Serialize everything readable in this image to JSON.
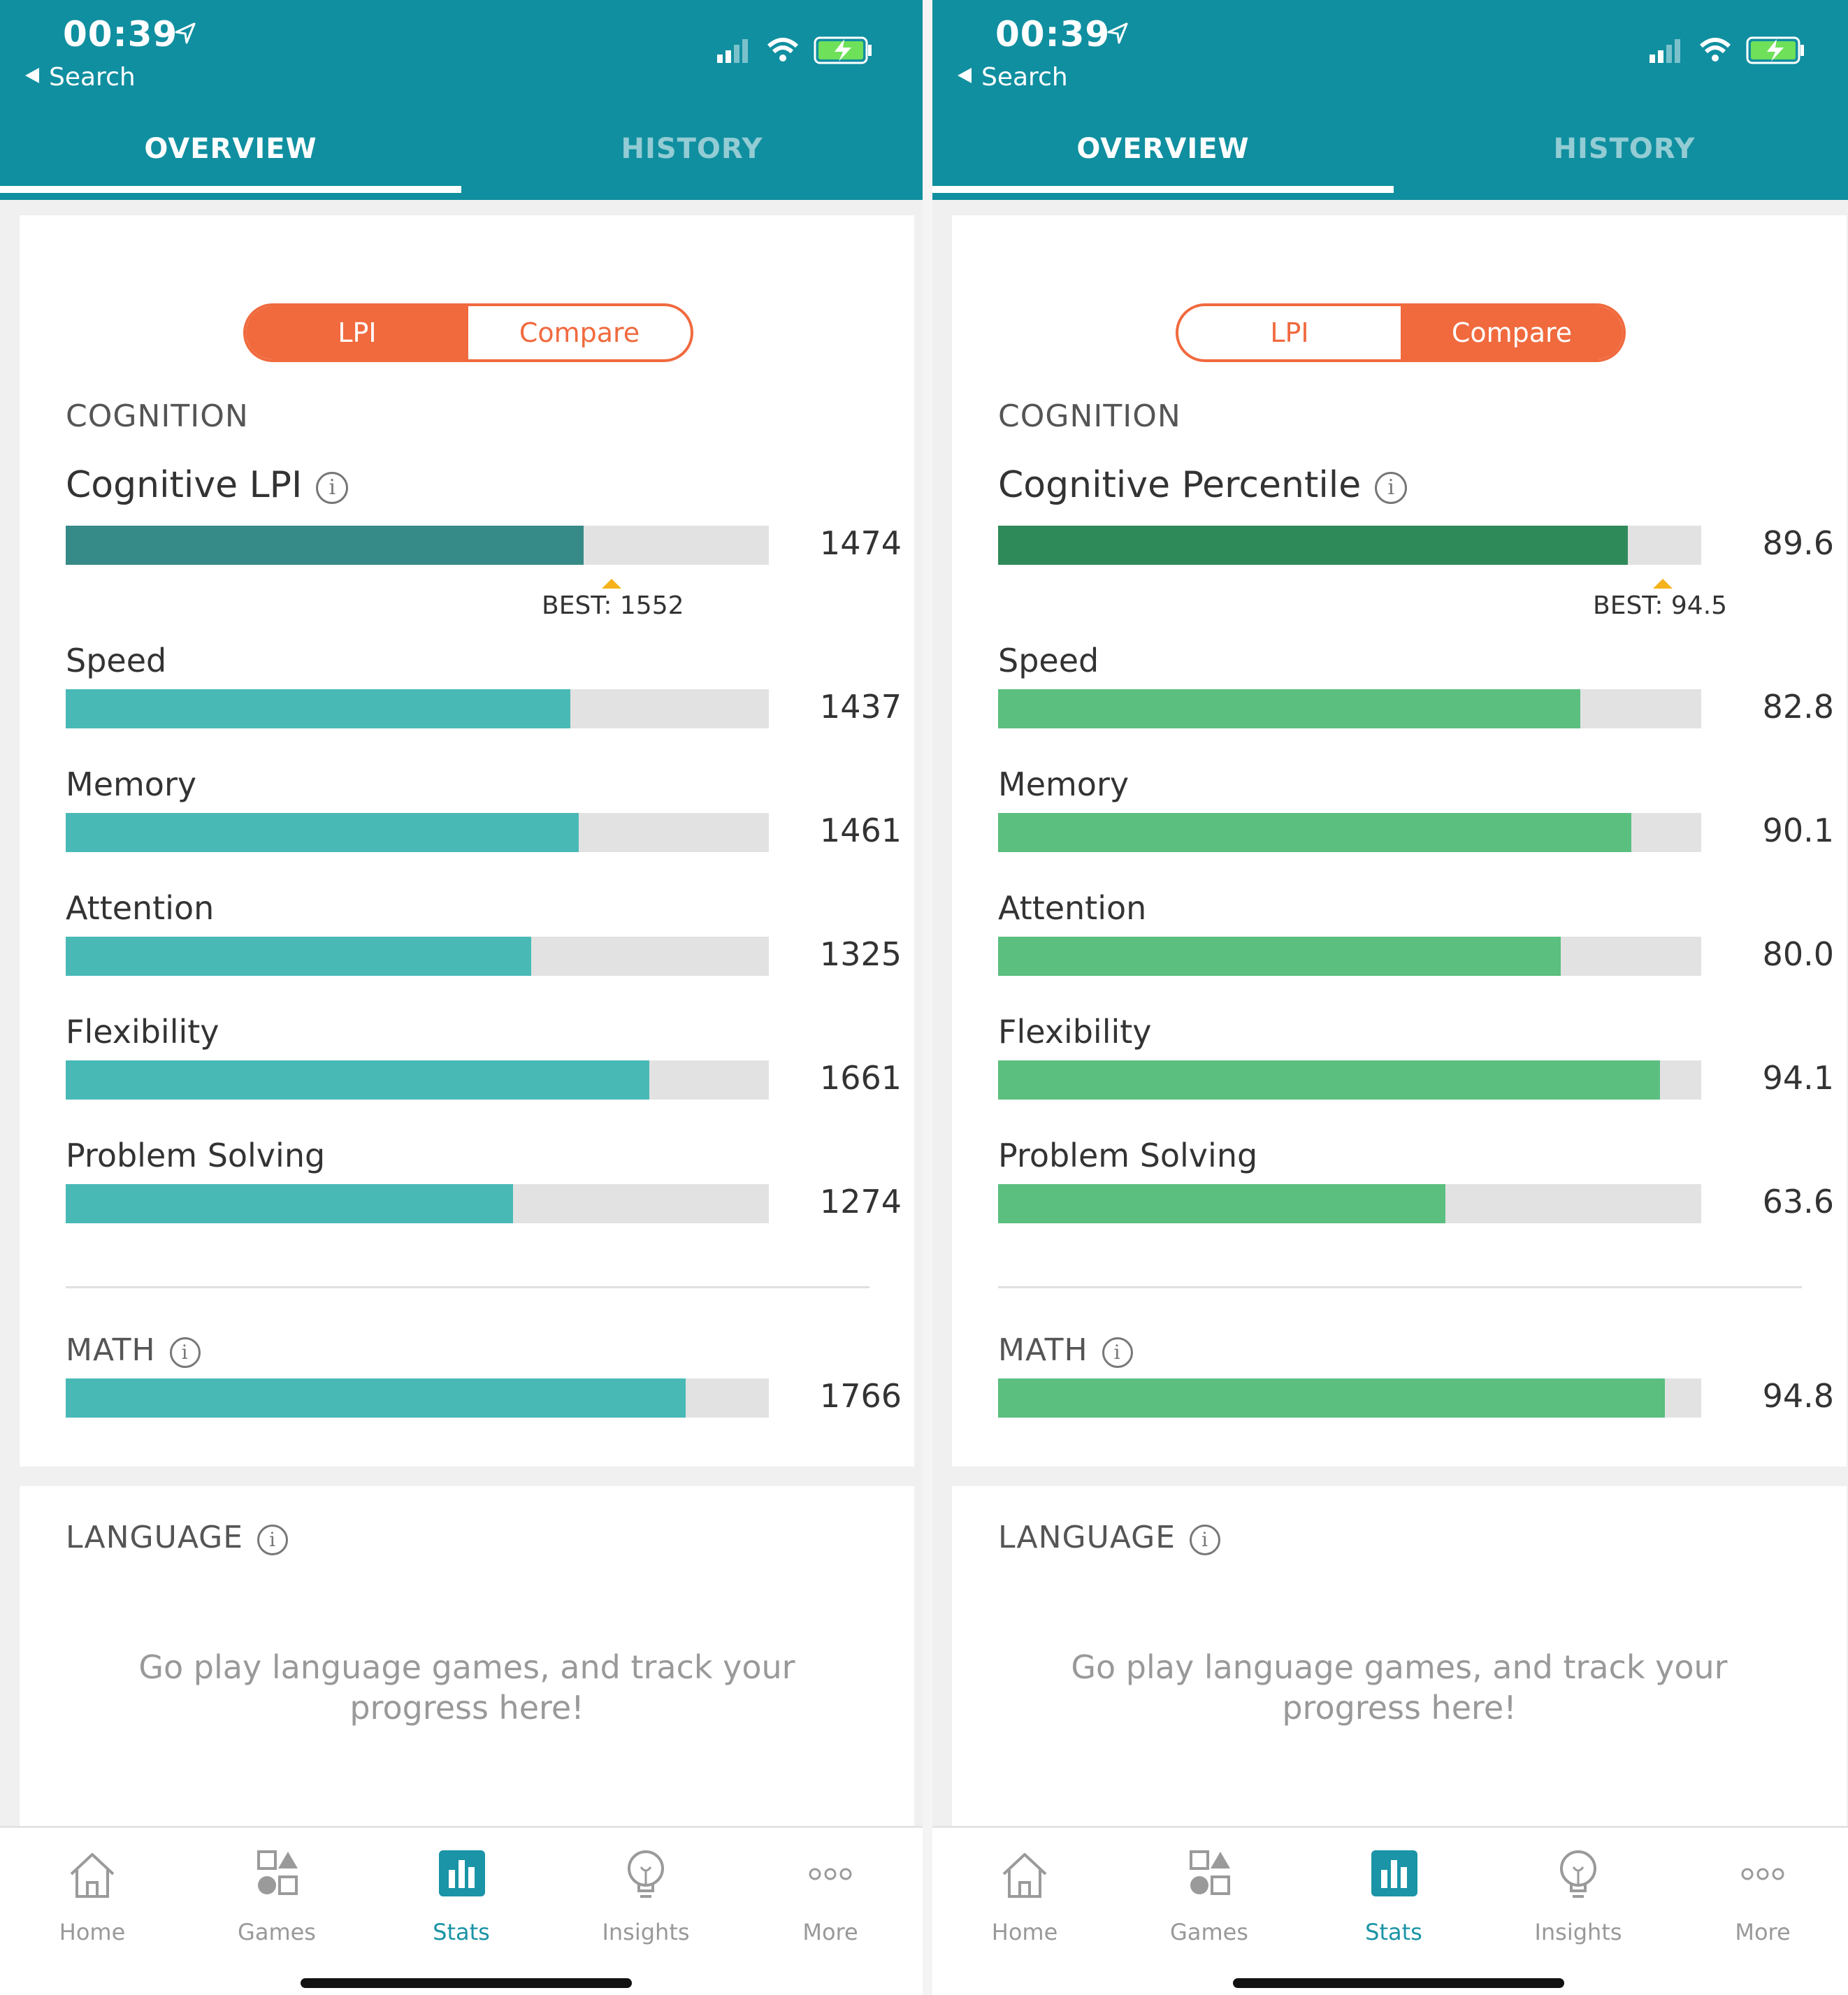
{
  "screens": [
    {
      "status_bar": {
        "time": "00:39",
        "back_label": "Search"
      },
      "tabs": {
        "overview": "OVERVIEW",
        "history": "HISTORY",
        "active": "overview"
      },
      "toggle": {
        "first": "LPI",
        "second": "Compare",
        "active": "first"
      },
      "cognition": {
        "title": "COGNITION",
        "metric_title": "Cognitive LPI",
        "overall": {
          "value": "1474",
          "fraction": 0.737,
          "best_label": "BEST: 1552",
          "best_fraction": 0.776
        },
        "items": [
          {
            "label": "Speed",
            "value": "1437",
            "fraction": 0.718
          },
          {
            "label": "Memory",
            "value": "1461",
            "fraction": 0.73
          },
          {
            "label": "Attention",
            "value": "1325",
            "fraction": 0.662
          },
          {
            "label": "Flexibility",
            "value": "1661",
            "fraction": 0.83
          },
          {
            "label": "Problem Solving",
            "value": "1274",
            "fraction": 0.636
          }
        ]
      },
      "math": {
        "title": "MATH",
        "value": "1766",
        "fraction": 0.882
      },
      "language": {
        "title": "LANGUAGE",
        "message": "Go play language games, and track your progress here!"
      },
      "colors": {
        "overall_bar": "#368a87",
        "bar": "#49b9b6",
        "track": "#e2e2e2"
      }
    },
    {
      "status_bar": {
        "time": "00:39",
        "back_label": "Search"
      },
      "tabs": {
        "overview": "OVERVIEW",
        "history": "HISTORY",
        "active": "overview"
      },
      "toggle": {
        "first": "LPI",
        "second": "Compare",
        "active": "second"
      },
      "cognition": {
        "title": "COGNITION",
        "metric_title": "Cognitive Percentile",
        "overall": {
          "value": "89.6",
          "fraction": 0.896,
          "best_label": "BEST: 94.5",
          "best_fraction": 0.945
        },
        "items": [
          {
            "label": "Speed",
            "value": "82.8",
            "fraction": 0.828
          },
          {
            "label": "Memory",
            "value": "90.1",
            "fraction": 0.901
          },
          {
            "label": "Attention",
            "value": "80.0",
            "fraction": 0.8
          },
          {
            "label": "Flexibility",
            "value": "94.1",
            "fraction": 0.941
          },
          {
            "label": "Problem Solving",
            "value": "63.6",
            "fraction": 0.636
          }
        ]
      },
      "math": {
        "title": "MATH",
        "value": "94.8",
        "fraction": 0.948
      },
      "language": {
        "title": "LANGUAGE",
        "message": "Go play language games, and track your progress here!"
      },
      "colors": {
        "overall_bar": "#2f8a5a",
        "bar": "#5bbf80",
        "track": "#e2e2e2"
      }
    }
  ],
  "bottom_nav": [
    {
      "label": "Home",
      "icon": "home-icon",
      "active": false
    },
    {
      "label": "Games",
      "icon": "games-icon",
      "active": false
    },
    {
      "label": "Stats",
      "icon": "stats-icon",
      "active": true
    },
    {
      "label": "Insights",
      "icon": "lightbulb-icon",
      "active": false
    },
    {
      "label": "More",
      "icon": "more-icon",
      "active": false
    }
  ],
  "theme": {
    "header": "#108fa0",
    "accent_orange": "#f06a3e",
    "active_nav": "#1a94a6",
    "best_marker": "#f5b21b"
  }
}
